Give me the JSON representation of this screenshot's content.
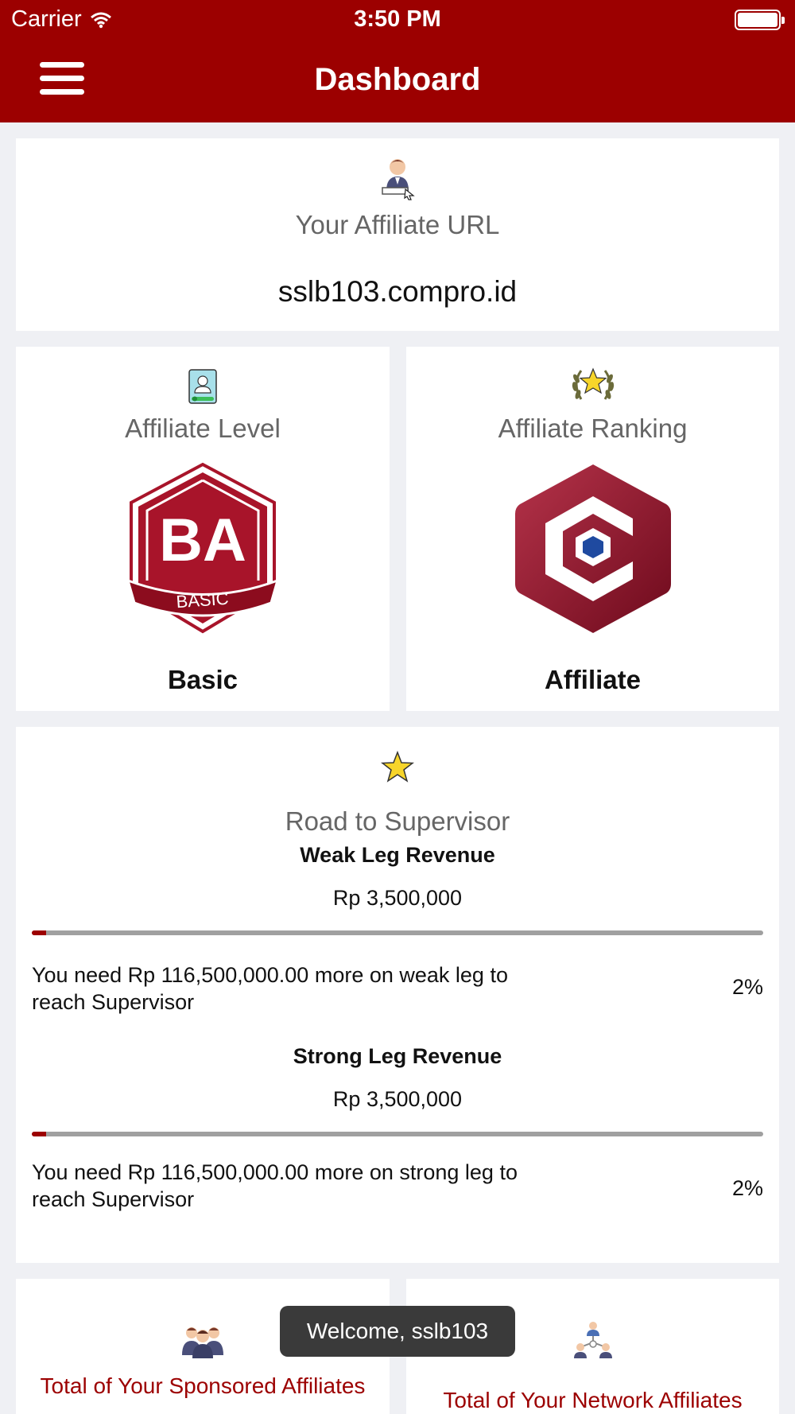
{
  "status_bar": {
    "carrier": "Carrier",
    "time": "3:50 PM"
  },
  "header": {
    "title": "Dashboard",
    "menu_icon": "hamburger-menu-icon"
  },
  "affiliate_url": {
    "label": "Your Affiliate URL",
    "value": "sslb103.compro.id",
    "icon": "user-at-computer-icon"
  },
  "affiliate_level": {
    "label": "Affiliate Level",
    "badge_abbr": "BA",
    "badge_ribbon": "BASIC",
    "value": "Basic",
    "icon": "member-card-icon"
  },
  "affiliate_ranking": {
    "label": "Affiliate Ranking",
    "value": "Affiliate",
    "icon": "laurel-star-icon"
  },
  "road": {
    "title": "Road to Supervisor",
    "icon": "star-icon",
    "weak": {
      "heading": "Weak Leg Revenue",
      "amount": "Rp 3,500,000",
      "progress": 0.02,
      "need_text": "You need Rp 116,500,000.00 more on weak leg to reach Supervisor",
      "percent": "2%"
    },
    "strong": {
      "heading": "Strong Leg Revenue",
      "amount": "Rp 3,500,000",
      "progress": 0.02,
      "need_text": "You need Rp 116,500,000.00 more on strong leg to reach Supervisor",
      "percent": "2%"
    }
  },
  "stats": {
    "sponsored_label": "Total of Your Sponsored Affiliates",
    "network_label": "Total of Your Network Affiliates",
    "sponsored_icon": "group-icon",
    "network_icon": "network-icon"
  },
  "toast": {
    "text": "Welcome, sslb103"
  },
  "colors": {
    "brand": "#9c0000",
    "background": "#eff0f4"
  }
}
